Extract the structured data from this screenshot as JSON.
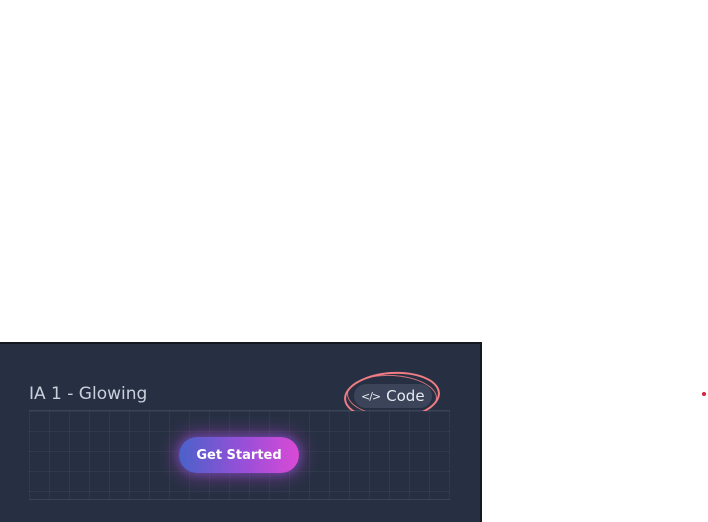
{
  "card": {
    "title": "IA 1 - Glowing",
    "code_button_label": "Code",
    "code_icon": "code-brackets-icon",
    "code_icon_glyph": "</>"
  },
  "preview": {
    "button_label": "Get Started"
  },
  "colors": {
    "card_background": "#273043",
    "highlight_ring": "#f07c84",
    "button_gradient_start": "#4a62c9",
    "button_gradient_end": "#d94ad6"
  }
}
